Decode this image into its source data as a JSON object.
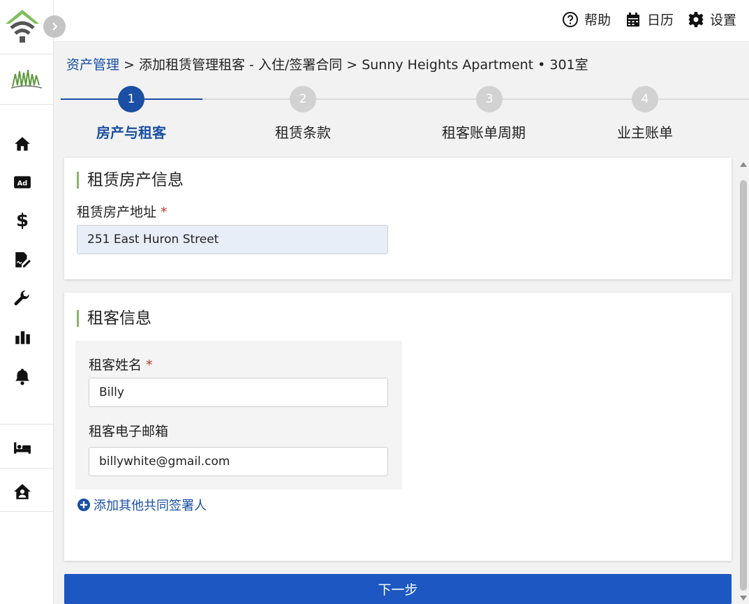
{
  "sidebar": {
    "collapse_icon": "chevron-right-icon",
    "items": [
      {
        "icon": "home-icon"
      },
      {
        "icon": "ad-icon",
        "text": "Ad"
      },
      {
        "icon": "dollar-icon",
        "text": "$"
      },
      {
        "icon": "sign-document-icon"
      },
      {
        "icon": "wrench-icon"
      },
      {
        "icon": "bar-chart-icon"
      },
      {
        "icon": "bell-icon"
      },
      {
        "icon": "bed-icon"
      },
      {
        "icon": "house-user-icon"
      }
    ]
  },
  "topbar": {
    "help_label": "帮助",
    "calendar_label": "日历",
    "settings_label": "设置"
  },
  "breadcrumb": {
    "root": "资产管理",
    "separator": ">",
    "middle": "添加租赁管理租客 - 入住/签署合同",
    "current": "Sunny Heights Apartment • 301室"
  },
  "stepper": {
    "steps": [
      {
        "number": "1",
        "label": "房产与租客",
        "active": true
      },
      {
        "number": "2",
        "label": "租赁条款",
        "active": false
      },
      {
        "number": "3",
        "label": "租客账单周期",
        "active": false
      },
      {
        "number": "4",
        "label": "业主账单",
        "active": false
      }
    ]
  },
  "property_section": {
    "title": "租赁房产信息",
    "address_label": "租赁房产地址",
    "required_mark": "*",
    "address_value": "251 East Huron Street"
  },
  "tenant_section": {
    "title": "租客信息",
    "name_label": "租客姓名",
    "required_mark": "*",
    "name_value": "Billy",
    "email_label": "租客电子邮箱",
    "email_value": "billywhite@gmail.com",
    "add_cosigner_label": "添加其他共同签署人"
  },
  "next_button_label": "下一步",
  "colors": {
    "accent": "#1a4fa3",
    "primary_button": "#1d57c2",
    "section_bar": "#8cb369",
    "logo_green": "#7fbf5a",
    "required": "#c0392b"
  }
}
